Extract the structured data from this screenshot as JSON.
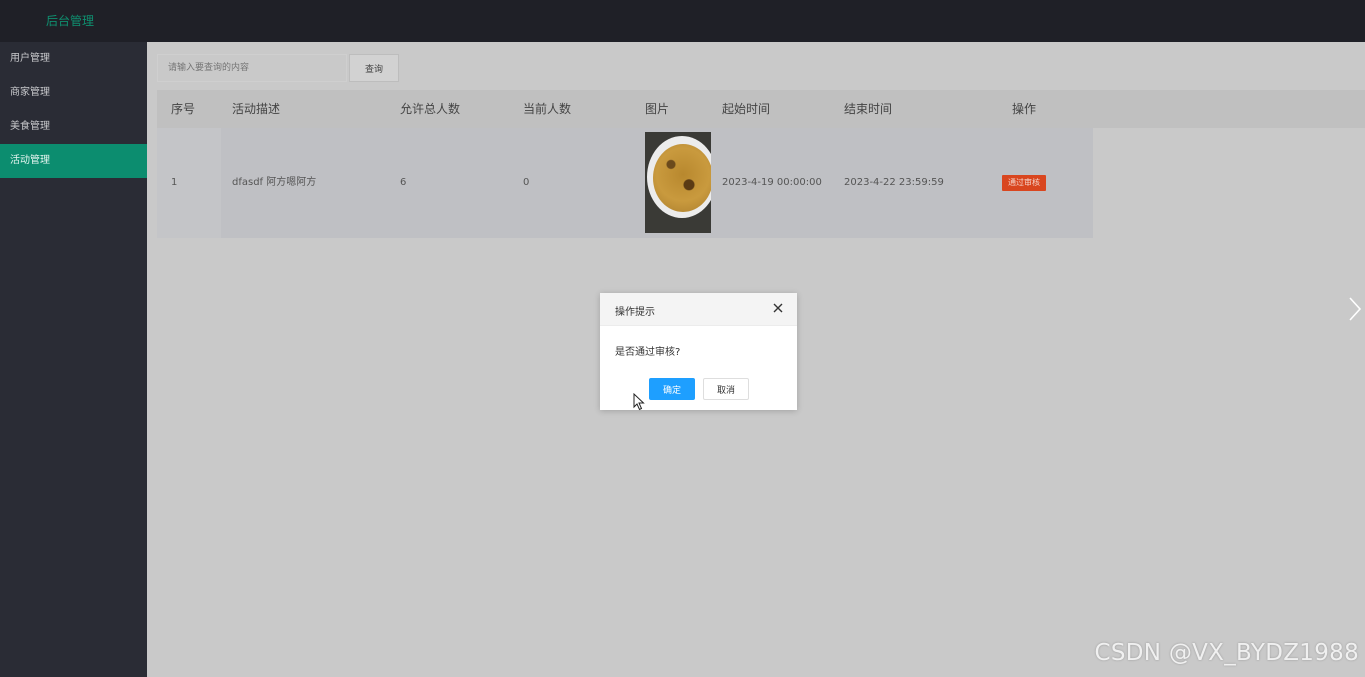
{
  "app": {
    "title": "后台管理"
  },
  "sidebar": {
    "items": [
      {
        "label": "用户管理",
        "active": false
      },
      {
        "label": "商家管理",
        "active": false
      },
      {
        "label": "美食管理",
        "active": false
      },
      {
        "label": "活动管理",
        "active": true
      }
    ]
  },
  "search": {
    "placeholder": "请输入要查询的内容",
    "button_label": "查询"
  },
  "table": {
    "columns": [
      "序号",
      "活动描述",
      "允许总人数",
      "当前人数",
      "图片",
      "起始时间",
      "结束时间",
      "操作"
    ],
    "rows": [
      {
        "index": "1",
        "description": "dfasdf 阿方嗯阿方",
        "max_people": "6",
        "current_people": "0",
        "image": "food-photo",
        "start_time": "2023-4-19 00:00:00",
        "end_time": "2023-4-22 23:59:59",
        "action_label": "通过审核"
      }
    ]
  },
  "dialog": {
    "title": "操作提示",
    "message": "是否通过审核?",
    "confirm_label": "确定",
    "cancel_label": "取消"
  },
  "watermark": "CSDN @VX_BYDZ1988",
  "colors": {
    "accent": "#0c8d6f",
    "danger": "#d9461f",
    "primary_button": "#1e9fff"
  }
}
